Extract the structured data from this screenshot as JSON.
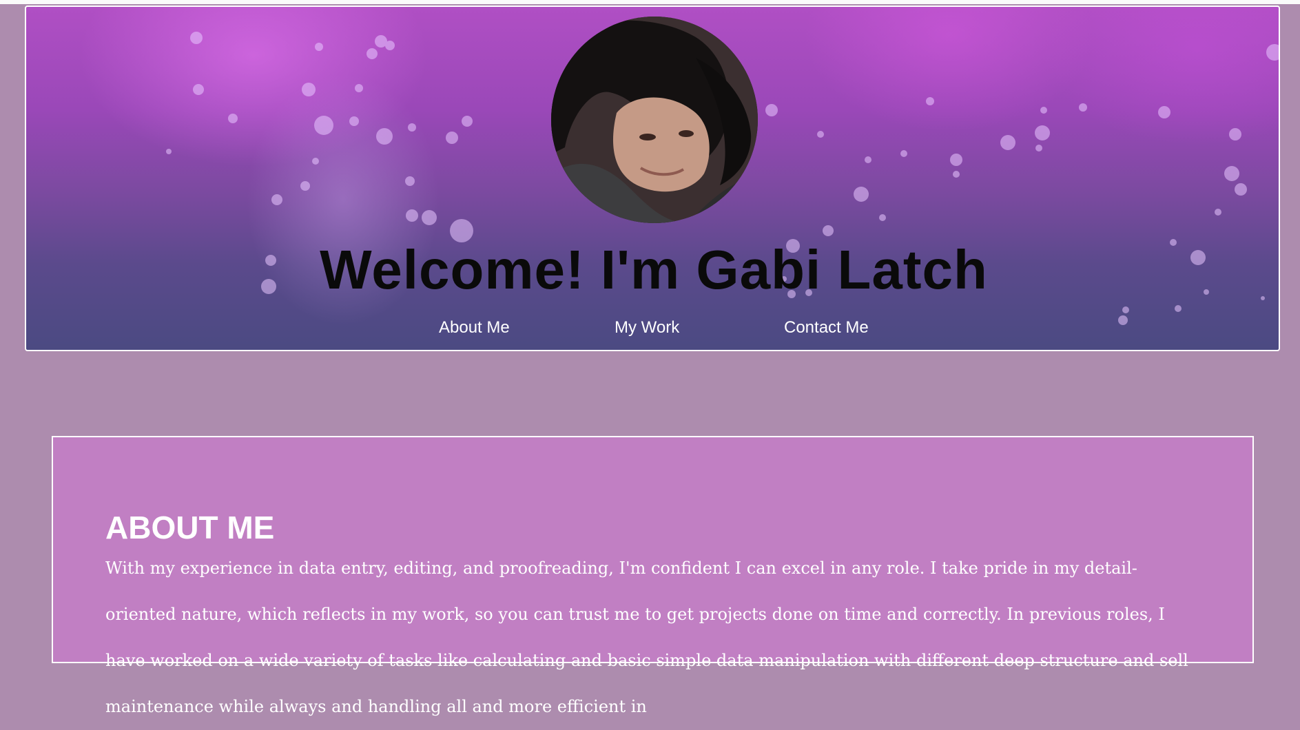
{
  "header": {
    "title": "Welcome! I'm Gabi Latch",
    "avatar_alt": "Portrait photo of Gabi Latch"
  },
  "nav": {
    "items": [
      {
        "label": "About Me"
      },
      {
        "label": "My Work"
      },
      {
        "label": "Contact Me"
      }
    ]
  },
  "about": {
    "heading": "ABOUT ME",
    "body": "With my experience in data entry, editing, and proofreading, I'm confident I can excel in any role. I take pride in my detail-oriented nature, which reflects in my work, so you can trust me to get projects done on time and correctly. In previous roles, I have worked on a wide variety of tasks like calculating and basic simple data manipulation with different deep structure and sell maintenance while always and handling all and more efficient in",
    "body_note": ""
  },
  "colors": {
    "page_background": "#ad8cae",
    "about_background": "#c17fc3",
    "border": "#ffffff",
    "title_text": "#0a0a0a",
    "nav_text": "#ffffff"
  }
}
